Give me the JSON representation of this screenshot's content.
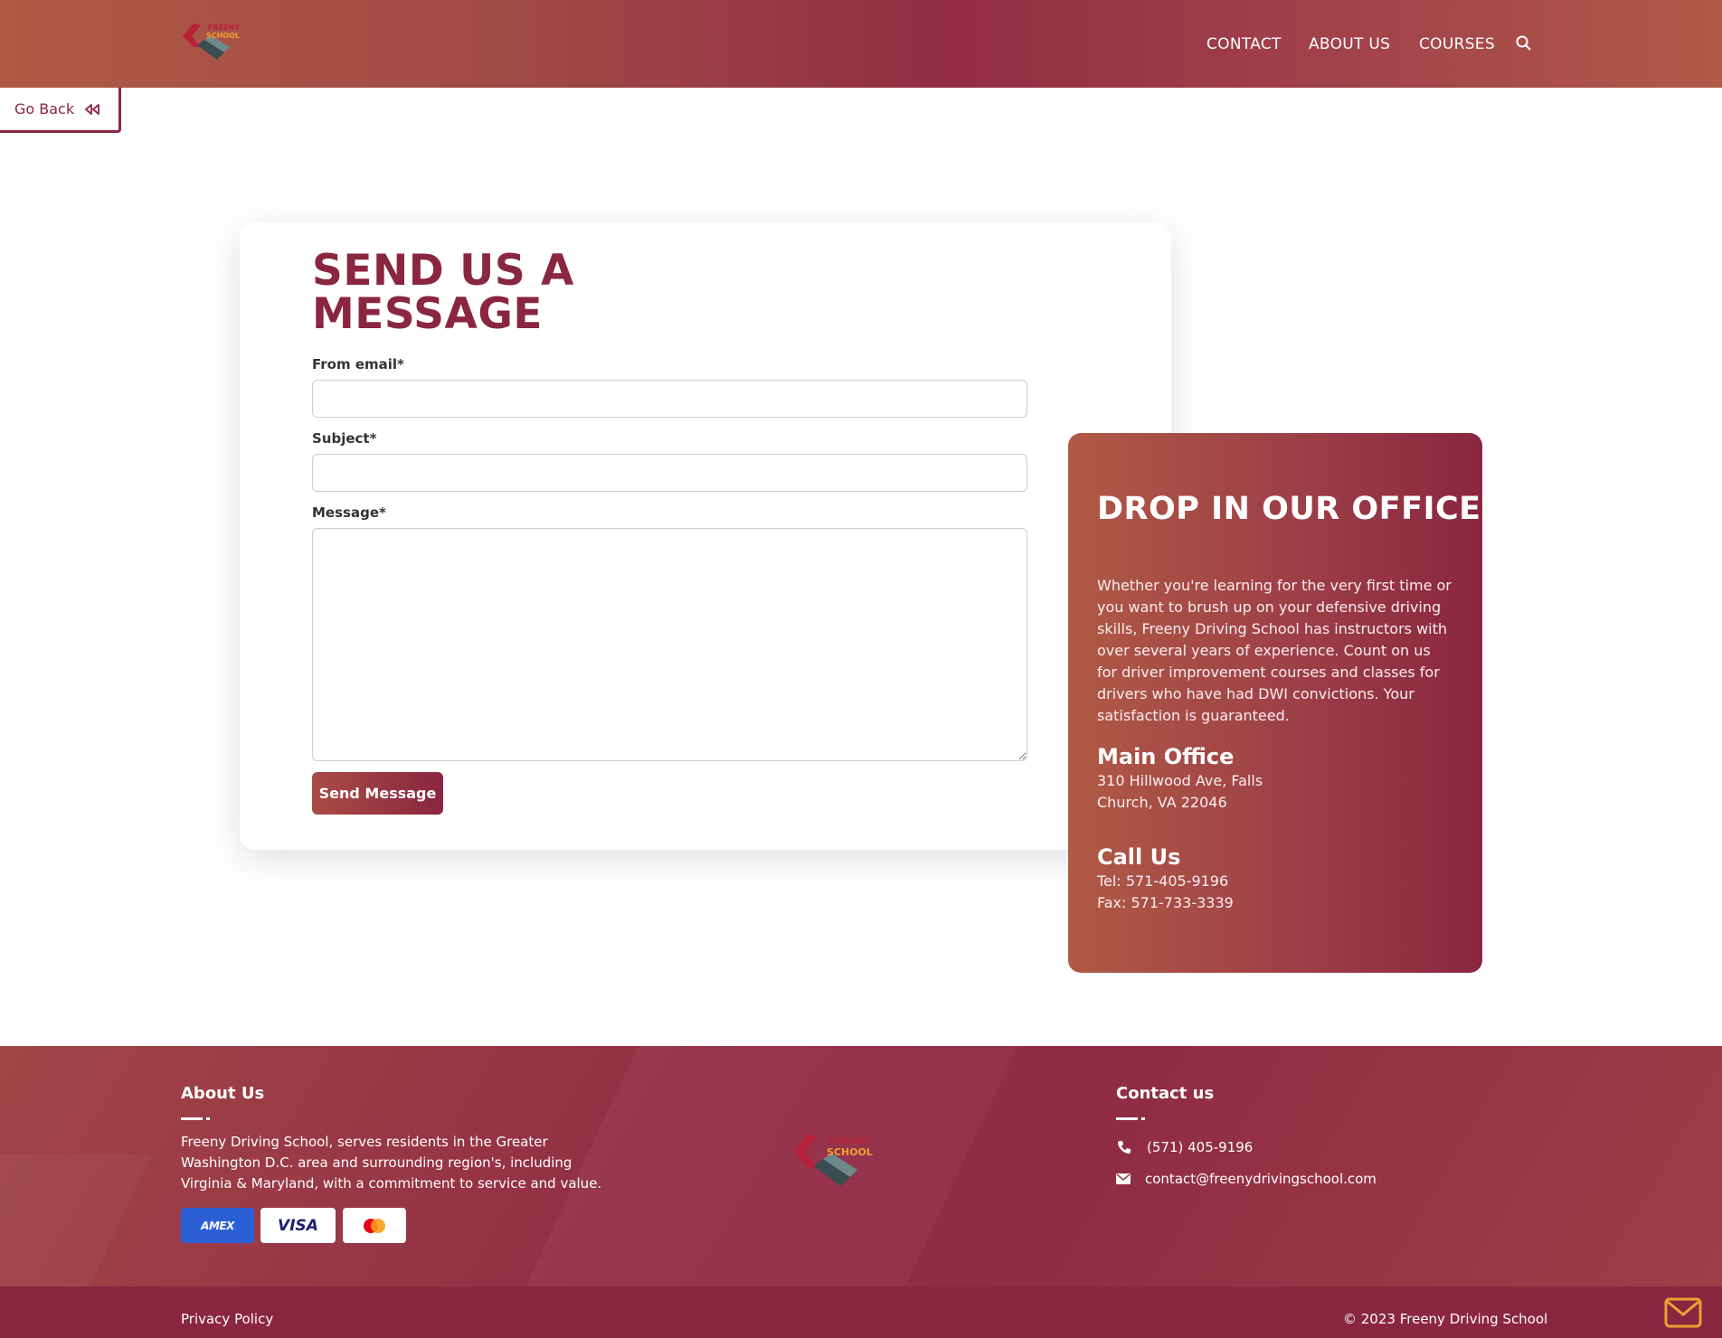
{
  "nav": {
    "items": [
      "CONTACT",
      "ABOUT US",
      "COURSES"
    ],
    "logo_text_top": "FREENY",
    "logo_text_bottom": "SCHOOL"
  },
  "go_back": {
    "label": "Go Back"
  },
  "form": {
    "title": "SEND US A MESSAGE",
    "email_label": "From email*",
    "subject_label": "Subject*",
    "message_label": "Message*",
    "email_value": "",
    "subject_value": "",
    "message_value": "",
    "submit_label": "Send Message"
  },
  "office": {
    "title": "DROP IN OUR OFFICE",
    "description": "Whether you're learning for the very first time or you want to brush up on your defensive driving skills, Freeny Driving School has instructors with over several years of experience. Count on us for driver improvement courses and classes for drivers who have had DWI convictions. Your satisfaction is guaranteed.",
    "main_office_heading": "Main Office",
    "address_line1": "310 Hillwood Ave, Falls",
    "address_line2": "Church, VA 22046",
    "call_heading": "Call Us",
    "tel": "Tel: 571-405-9196",
    "fax": "Fax: 571-733-3339"
  },
  "footer": {
    "about_heading": "About Us",
    "about_text": "Freeny Driving School, serves residents in the Greater Washington D.C. area and surrounding region's, including Virginia & Maryland, with a commitment to service and value.",
    "payments": [
      "AMEX",
      "VISA",
      "MasterCard"
    ],
    "contact_heading": "Contact us",
    "phone": "(571) 405-9196",
    "email": "contact@freenydrivingschool.com",
    "privacy": "Privacy Policy",
    "copyright": "© 2023 Freeny Driving School"
  },
  "colors": {
    "brand": "#8a2640",
    "brand_light": "#b05a45"
  }
}
